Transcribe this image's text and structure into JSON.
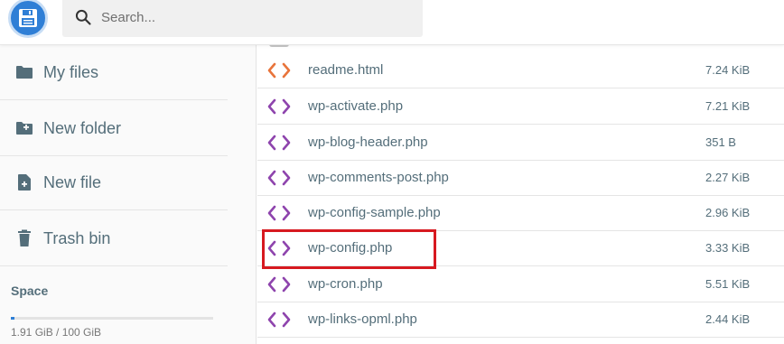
{
  "header": {
    "search_placeholder": "Search..."
  },
  "sidebar": {
    "items": [
      {
        "label": "My files",
        "icon": "folder-icon"
      },
      {
        "label": "New folder",
        "icon": "new-folder-icon"
      },
      {
        "label": "New file",
        "icon": "new-file-icon"
      },
      {
        "label": "Trash bin",
        "icon": "trash-icon"
      }
    ],
    "space": {
      "title": "Space",
      "usage_text": "1.91 GiB / 100 GiB",
      "used_fraction": 0.0191
    }
  },
  "files": [
    {
      "name": "readme.html",
      "size": "7.24 KiB",
      "icon": "html-code-icon"
    },
    {
      "name": "wp-activate.php",
      "size": "7.21 KiB",
      "icon": "php-code-icon"
    },
    {
      "name": "wp-blog-header.php",
      "size": "351 B",
      "icon": "php-code-icon"
    },
    {
      "name": "wp-comments-post.php",
      "size": "2.27 KiB",
      "icon": "php-code-icon"
    },
    {
      "name": "wp-config-sample.php",
      "size": "2.96 KiB",
      "icon": "php-code-icon"
    },
    {
      "name": "wp-config.php",
      "size": "3.33 KiB",
      "icon": "php-code-icon"
    },
    {
      "name": "wp-cron.php",
      "size": "5.51 KiB",
      "icon": "php-code-icon"
    },
    {
      "name": "wp-links-opml.php",
      "size": "2.44 KiB",
      "icon": "php-code-icon"
    }
  ],
  "colors": {
    "accent": "#2f7fd6",
    "html_icon": "#e8743b",
    "php_icon": "#8e44ad",
    "highlight": "#d71920",
    "text": "#546e7a"
  }
}
